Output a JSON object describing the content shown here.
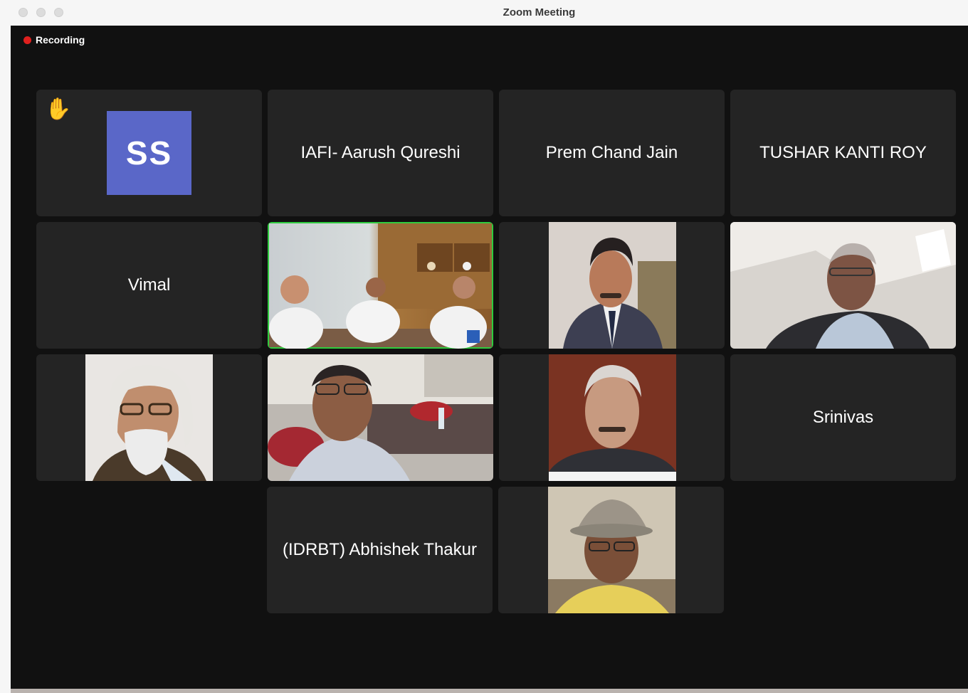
{
  "window": {
    "title": "Zoom Meeting"
  },
  "recording": {
    "label": "Recording",
    "color": "#e0201e"
  },
  "participants": [
    {
      "name": "SS",
      "initials": "SS",
      "raised_hand": true,
      "avatar_color": "#5a67c8"
    },
    {
      "name": "IAFI- Aarush Qureshi"
    },
    {
      "name": "Prem Chand Jain"
    },
    {
      "name": "TUSHAR KANTI ROY"
    },
    {
      "name": "Vimal"
    },
    {
      "video": "meeting-room-video",
      "active_speaker": true
    },
    {
      "video": "portrait-photo"
    },
    {
      "video": "office-video"
    },
    {
      "video": "portrait-photo"
    },
    {
      "video": "office-video"
    },
    {
      "video": "portrait-photo"
    },
    {
      "name": "Srinivas"
    },
    {
      "name": "(IDRBT) Abhishek Thakur"
    },
    {
      "video": "portrait-photo"
    }
  ],
  "colors": {
    "stage": "#111111",
    "tile": "#242424",
    "active_border": "#2fcb3f"
  }
}
